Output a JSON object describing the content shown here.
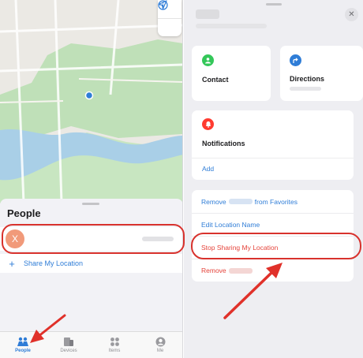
{
  "left": {
    "sheet": {
      "title": "People",
      "person": {
        "avatar_initial": "X"
      },
      "share_label": "Share My Location"
    },
    "tabs": [
      {
        "label": "People",
        "icon": "people-icon",
        "active": true
      },
      {
        "label": "Devices",
        "icon": "devices-icon",
        "active": false
      },
      {
        "label": "Items",
        "icon": "items-icon",
        "active": false
      },
      {
        "label": "Me",
        "icon": "me-icon",
        "active": false
      }
    ]
  },
  "right": {
    "contact_label": "Contact",
    "directions_label": "Directions",
    "notifications": {
      "title": "Notifications",
      "add_label": "Add"
    },
    "options": {
      "remove_favorites_prefix": "Remove",
      "remove_favorites_suffix": "from Favorites",
      "edit_location_name": "Edit Location Name",
      "stop_sharing": "Stop Sharing My Location",
      "remove_prefix": "Remove"
    }
  },
  "colors": {
    "accent_blue": "#2f7dd7",
    "destructive_red": "#e5443b",
    "annotation_red": "#d8322d",
    "contact_green": "#34c759",
    "directions_blue": "#2f7dd7",
    "notifications_red": "#ff3b30"
  }
}
